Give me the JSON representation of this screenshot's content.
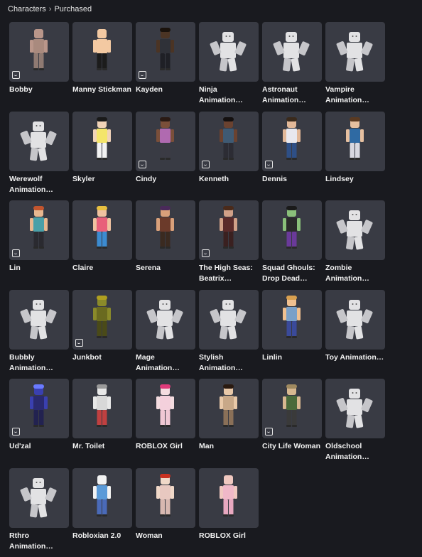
{
  "breadcrumb": {
    "root": "Characters",
    "separator": "›",
    "current": "Purchased"
  },
  "items": [
    {
      "name": "Bobby",
      "badge": true,
      "kind": "bobby"
    },
    {
      "name": "Manny Stickman",
      "badge": false,
      "kind": "manny"
    },
    {
      "name": "Kayden",
      "badge": true,
      "kind": "kayden"
    },
    {
      "name": "Ninja Animation…",
      "badge": false,
      "kind": "anim"
    },
    {
      "name": "Astronaut Animation…",
      "badge": false,
      "kind": "anim"
    },
    {
      "name": "Vampire Animation…",
      "badge": false,
      "kind": "anim"
    },
    {
      "name": "Werewolf Animation…",
      "badge": false,
      "kind": "anim"
    },
    {
      "name": "Skyler",
      "badge": false,
      "kind": "skyler"
    },
    {
      "name": "Cindy",
      "badge": true,
      "kind": "cindy"
    },
    {
      "name": "Kenneth",
      "badge": true,
      "kind": "kenneth"
    },
    {
      "name": "Dennis",
      "badge": true,
      "kind": "dennis"
    },
    {
      "name": "Lindsey",
      "badge": false,
      "kind": "lindsey"
    },
    {
      "name": "Lin",
      "badge": true,
      "kind": "lin"
    },
    {
      "name": "Claire",
      "badge": false,
      "kind": "claire"
    },
    {
      "name": "Serena",
      "badge": false,
      "kind": "serena"
    },
    {
      "name": "The High Seas: Beatrix…",
      "badge": true,
      "kind": "beatrix"
    },
    {
      "name": "Squad Ghouls: Drop Dead…",
      "badge": false,
      "kind": "ghoul"
    },
    {
      "name": "Zombie Animation…",
      "badge": false,
      "kind": "anim"
    },
    {
      "name": "Bubbly Animation…",
      "badge": false,
      "kind": "anim"
    },
    {
      "name": "Junkbot",
      "badge": true,
      "kind": "junkbot"
    },
    {
      "name": "Mage Animation…",
      "badge": false,
      "kind": "anim"
    },
    {
      "name": "Stylish Animation…",
      "badge": false,
      "kind": "anim"
    },
    {
      "name": "Linlin",
      "badge": false,
      "kind": "linlin"
    },
    {
      "name": "Toy Animation…",
      "badge": false,
      "kind": "anim"
    },
    {
      "name": "Ud'zal",
      "badge": true,
      "kind": "udzal"
    },
    {
      "name": "Mr. Toilet",
      "badge": false,
      "kind": "toilet"
    },
    {
      "name": "ROBLOX Girl",
      "badge": false,
      "kind": "girlpink"
    },
    {
      "name": "Man",
      "badge": false,
      "kind": "man"
    },
    {
      "name": "City Life Woman",
      "badge": true,
      "kind": "citywoman"
    },
    {
      "name": "Oldschool Animation…",
      "badge": false,
      "kind": "anim"
    },
    {
      "name": "Rthro Animation…",
      "badge": false,
      "kind": "anim"
    },
    {
      "name": "Robloxian 2.0",
      "badge": false,
      "kind": "robloxian"
    },
    {
      "name": "Woman",
      "badge": false,
      "kind": "woman"
    },
    {
      "name": "ROBLOX Girl",
      "badge": false,
      "kind": "girlpink2"
    }
  ]
}
